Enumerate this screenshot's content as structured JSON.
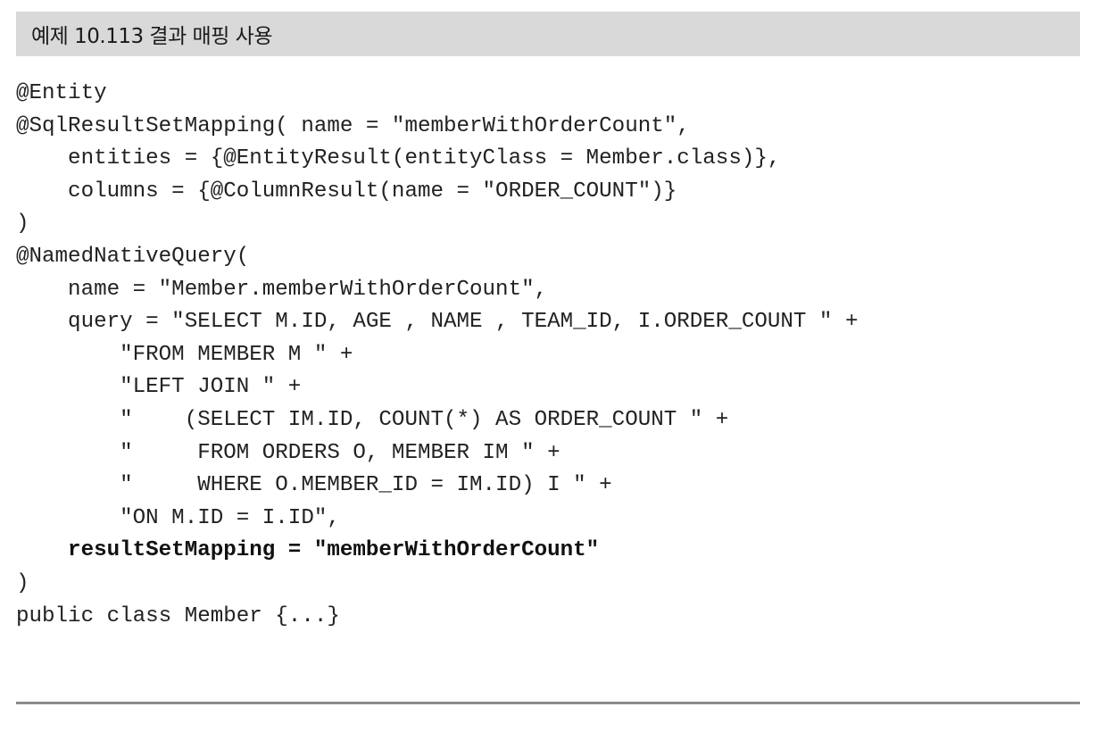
{
  "header": {
    "title": "예제 10.113 결과 매핑 사용"
  },
  "code": {
    "lines": [
      {
        "text": "@Entity",
        "bold": false
      },
      {
        "text": "@SqlResultSetMapping( name = \"memberWithOrderCount\",",
        "bold": false
      },
      {
        "text": "    entities = {@EntityResult(entityClass = Member.class)},",
        "bold": false
      },
      {
        "text": "    columns = {@ColumnResult(name = \"ORDER_COUNT\")}",
        "bold": false
      },
      {
        "text": ")",
        "bold": false
      },
      {
        "text": "@NamedNativeQuery(",
        "bold": false
      },
      {
        "text": "    name = \"Member.memberWithOrderCount\",",
        "bold": false
      },
      {
        "text": "    query = \"SELECT M.ID, AGE , NAME , TEAM_ID, I.ORDER_COUNT \" +",
        "bold": false
      },
      {
        "text": "        \"FROM MEMBER M \" +",
        "bold": false
      },
      {
        "text": "        \"LEFT JOIN \" +",
        "bold": false
      },
      {
        "text": "        \"    (SELECT IM.ID, COUNT(*) AS ORDER_COUNT \" +",
        "bold": false
      },
      {
        "text": "        \"     FROM ORDERS O, MEMBER IM \" +",
        "bold": false
      },
      {
        "text": "        \"     WHERE O.MEMBER_ID = IM.ID) I \" +",
        "bold": false
      },
      {
        "text": "        \"ON M.ID = I.ID\",",
        "bold": false
      },
      {
        "text": "    resultSetMapping = \"memberWithOrderCount\"",
        "bold": true
      },
      {
        "text": ")",
        "bold": false
      },
      {
        "text": "public class Member {...}",
        "bold": false
      }
    ]
  },
  "colors": {
    "header_background": "#d9d9d9",
    "code_text": "#222222",
    "rule": "#8c8c8c"
  }
}
